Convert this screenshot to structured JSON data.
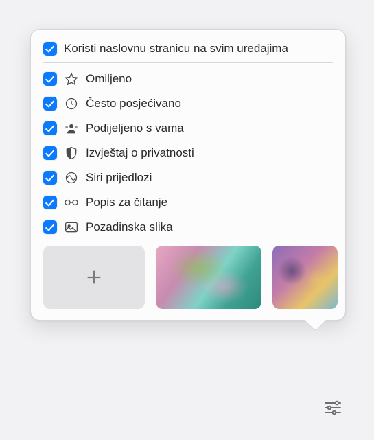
{
  "header": {
    "label": "Koristi naslovnu stranicu na svim uređajima",
    "checked": true
  },
  "items": [
    {
      "label": "Omiljeno",
      "checked": true,
      "icon": "star"
    },
    {
      "label": "Često posjećivano",
      "checked": true,
      "icon": "clock"
    },
    {
      "label": "Podijeljeno s vama",
      "checked": true,
      "icon": "people"
    },
    {
      "label": "Izvještaj o privatnosti",
      "checked": true,
      "icon": "shield"
    },
    {
      "label": "Siri prijedlozi",
      "checked": true,
      "icon": "siri"
    },
    {
      "label": "Popis za čitanje",
      "checked": true,
      "icon": "glasses"
    },
    {
      "label": "Pozadinska slika",
      "checked": true,
      "icon": "image"
    }
  ],
  "thumbnails": {
    "add": true,
    "images": [
      "butterfly-abstract",
      "bear-abstract"
    ]
  }
}
